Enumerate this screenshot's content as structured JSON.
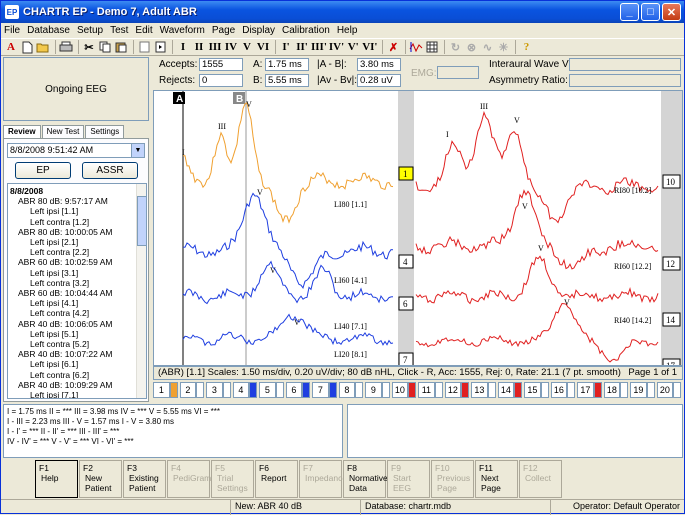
{
  "window": {
    "title": "CHARTR EP - Demo  7, Adult ABR",
    "app_icon": "EP"
  },
  "menu": [
    "File",
    "Database",
    "Setup",
    "Test",
    "Edit",
    "Waveform",
    "Page",
    "Display",
    "Calibration",
    "Help"
  ],
  "toolbar": {
    "buttons": [
      "A",
      "I",
      "II",
      "III",
      "IV",
      "V",
      "VI",
      "I'",
      "II'",
      "III'",
      "IV'",
      "V'",
      "VI'"
    ]
  },
  "left": {
    "ongoing_eeg": "Ongoing EEG",
    "tabs": [
      "Review",
      "New Test",
      "Settings"
    ],
    "date_value": "8/8/2008 9:51:42 AM",
    "ep_button": "EP",
    "assr_button": "ASSR",
    "tree": [
      {
        "label": "8/8/2008",
        "level": 0,
        "bold": true
      },
      {
        "label": "ABR 80 dB: 9:57:17 AM",
        "level": 1
      },
      {
        "label": "Left ipsi [1.1]",
        "level": 2
      },
      {
        "label": "Left contra [1.2]",
        "level": 2
      },
      {
        "label": "ABR 80 dB: 10:00:05 AM",
        "level": 1
      },
      {
        "label": "Left ipsi [2.1]",
        "level": 2
      },
      {
        "label": "Left contra [2.2]",
        "level": 2
      },
      {
        "label": "ABR 60 dB: 10:02:59 AM",
        "level": 1
      },
      {
        "label": "Left ipsi [3.1]",
        "level": 2
      },
      {
        "label": "Left contra [3.2]",
        "level": 2
      },
      {
        "label": "ABR 60 dB: 10:04:44 AM",
        "level": 1
      },
      {
        "label": "Left ipsi [4.1]",
        "level": 2
      },
      {
        "label": "Left contra [4.2]",
        "level": 2
      },
      {
        "label": "ABR 40 dB: 10:06:05 AM",
        "level": 1
      },
      {
        "label": "Left ipsi [5.1]",
        "level": 2
      },
      {
        "label": "Left contra [5.2]",
        "level": 2
      },
      {
        "label": "ABR 40 dB: 10:07:22 AM",
        "level": 1
      },
      {
        "label": "Left ipsi [6.1]",
        "level": 2
      },
      {
        "label": "Left contra [6.2]",
        "level": 2
      },
      {
        "label": "ABR 40 dB: 10:09:29 AM",
        "level": 1
      },
      {
        "label": "Left ipsi [7.1]",
        "level": 2
      }
    ]
  },
  "info": {
    "accepts_label": "Accepts:",
    "accepts": "1555",
    "rejects_label": "Rejects:",
    "rejects": "0",
    "a_label": "A:",
    "a": "1.75 ms",
    "b_label": "B:",
    "b": "5.55 ms",
    "ab_label": "|A - B|:",
    "ab": "3.80 ms",
    "avbv_label": "|Av - Bv|:",
    "avbv": "0.28 uV",
    "emg_label": "EMG:",
    "interaural_label": "Interaural Wave V:",
    "asym_label": "Asymmetry Ratio:"
  },
  "plot": {
    "cursor_a": "A",
    "cursor_b": "B",
    "left_labels": [
      "LI80 [1.1]",
      "LI60 [4.1]",
      "LI40 [7.1]",
      "LI20 [8.1]"
    ],
    "right_labels": [
      "RI80 [10.2]",
      "RI60 [12.2]",
      "RI40 [14.2]"
    ],
    "left_nums": [
      "1",
      "4",
      "6",
      "7"
    ],
    "right_nums": [
      "10",
      "12",
      "14",
      "17"
    ],
    "peak_labels": {
      "I": "I",
      "III": "III",
      "V": "V"
    }
  },
  "status_line": {
    "text": "(ABR) [1.1]  Scales: 1.50 ms/div,  0.20 uV/div;  80 dB nHL,  Click - R,  Acc: 1555,  Rej: 0,  Rate: 21.1 (7 pt. smooth)",
    "page": "Page 1 of 1"
  },
  "channels": [
    {
      "n": "1",
      "color": "#f0a030"
    },
    {
      "n": "2",
      "color": ""
    },
    {
      "n": "3",
      "color": ""
    },
    {
      "n": "4",
      "color": "#1f3fe0"
    },
    {
      "n": "5",
      "color": ""
    },
    {
      "n": "6",
      "color": "#1f3fe0"
    },
    {
      "n": "7",
      "color": "#1f3fe0"
    },
    {
      "n": "8",
      "color": ""
    },
    {
      "n": "9",
      "color": ""
    },
    {
      "n": "10",
      "color": "#e02020"
    },
    {
      "n": "11",
      "color": ""
    },
    {
      "n": "12",
      "color": "#e02020"
    },
    {
      "n": "13",
      "color": ""
    },
    {
      "n": "14",
      "color": "#e02020"
    },
    {
      "n": "15",
      "color": ""
    },
    {
      "n": "16",
      "color": ""
    },
    {
      "n": "17",
      "color": "#e02020"
    },
    {
      "n": "18",
      "color": ""
    },
    {
      "n": "19",
      "color": ""
    },
    {
      "n": "20",
      "color": ""
    }
  ],
  "results": [
    "I = 1.75 ms    II = ***    III = 3.98 ms    IV = ***    V = 5.55 ms    VI = ***",
    "I - III = 2.23 ms    III - V = 1.57 ms    I - V = 3.80 ms",
    "I - I' = ***    II - II' = ***    III - III' = ***",
    "IV - IV' = ***    V - V' = ***    VI - VI' = ***"
  ],
  "fkeys": [
    {
      "key": "F1",
      "label": "Help",
      "dim": false
    },
    {
      "key": "F2",
      "label": "New Patient",
      "dim": false
    },
    {
      "key": "F3",
      "label": "Existing Patient",
      "dim": false
    },
    {
      "key": "F4",
      "label": "PediGram",
      "dim": true
    },
    {
      "key": "F5",
      "label": "Trial Settings",
      "dim": true
    },
    {
      "key": "F6",
      "label": "Report",
      "dim": false
    },
    {
      "key": "F7",
      "label": "Impedance",
      "dim": true
    },
    {
      "key": "F8",
      "label": "Normative Data",
      "dim": false
    },
    {
      "key": "F9",
      "label": "Start EEG",
      "dim": true
    },
    {
      "key": "F10",
      "label": "Previous Page",
      "dim": true
    },
    {
      "key": "F11",
      "label": "Next Page",
      "dim": false
    },
    {
      "key": "F12",
      "label": "Collect",
      "dim": true
    }
  ],
  "statusbar": {
    "new": "New: ABR 40 dB",
    "database": "Database: chartr.mdb",
    "operator": "Operator: Default Operator"
  }
}
